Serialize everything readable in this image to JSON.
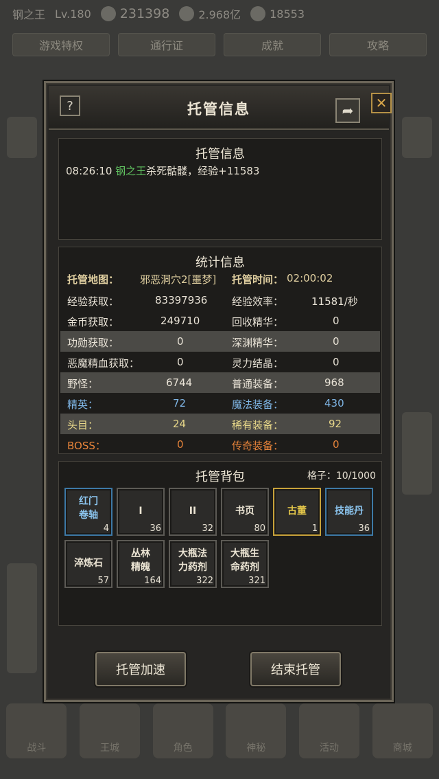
{
  "background": {
    "player_name": "钢之王",
    "player_level": "Lv.180",
    "stat_1": "231398",
    "stat_2": "2.968亿",
    "stat_3": "18553",
    "menu_tabs": [
      "游戏特权",
      "通行证",
      "成就",
      "攻略"
    ],
    "bottom_nav": [
      "战斗",
      "王城",
      "角色",
      "神秘",
      "活动",
      "商城"
    ]
  },
  "dialog": {
    "title": "托管信息",
    "help_label": "?",
    "share_label": "➦",
    "close_label": "✕"
  },
  "log": {
    "title": "托管信息",
    "time": "08:26:10",
    "player": "钢之王",
    "message": "杀死骷髅，经验+11583"
  },
  "stats": {
    "title": "统计信息",
    "map_label": "托管地图：",
    "map_value": "邪恶洞穴2[噩梦]",
    "time_label": "托管时间：",
    "time_value": "02:00:02",
    "rows": [
      {
        "l_label": "经验获取：",
        "l_value": "83397936",
        "r_label": "经验效率：",
        "r_value": "11581/秒"
      },
      {
        "l_label": "金币获取：",
        "l_value": "249710",
        "r_label": "回收精华：",
        "r_value": "0"
      },
      {
        "l_label": "功勋获取：",
        "l_value": "0",
        "r_label": "深渊精华：",
        "r_value": "0"
      },
      {
        "l_label": "恶魔精血获取：",
        "l_value": "0",
        "r_label": "灵力结晶：",
        "r_value": "0"
      },
      {
        "l_label": "野怪：",
        "l_value": "6744",
        "r_label": "普通装备：",
        "r_value": "968"
      },
      {
        "l_label": "精英：",
        "l_value": "72",
        "r_label": "魔法装备：",
        "r_value": "430"
      },
      {
        "l_label": "头目：",
        "l_value": "24",
        "r_label": "稀有装备：",
        "r_value": "92"
      },
      {
        "l_label": "BOSS：",
        "l_value": "0",
        "r_label": "传奇装备：",
        "r_value": "0"
      }
    ]
  },
  "bag": {
    "title": "托管背包",
    "slots_label": "格子：10/1000",
    "items": [
      {
        "name1": "红门",
        "name2": "卷轴",
        "count": "4"
      },
      {
        "name1": "I",
        "name2": "",
        "count": "36"
      },
      {
        "name1": "II",
        "name2": "",
        "count": "32"
      },
      {
        "name1": "书页",
        "name2": "",
        "count": "80"
      },
      {
        "name1": "古董",
        "name2": "",
        "count": "1"
      },
      {
        "name1": "技能丹",
        "name2": "",
        "count": "36"
      },
      {
        "name1": "淬炼石",
        "name2": "",
        "count": "57"
      },
      {
        "name1": "丛林",
        "name2": "精魄",
        "count": "164"
      },
      {
        "name1": "大瓶法",
        "name2": "力药剂",
        "count": "322"
      },
      {
        "name1": "大瓶生",
        "name2": "命药剂",
        "count": "321"
      }
    ]
  },
  "buttons": {
    "speed_up": "托管加速",
    "end": "结束托管"
  }
}
